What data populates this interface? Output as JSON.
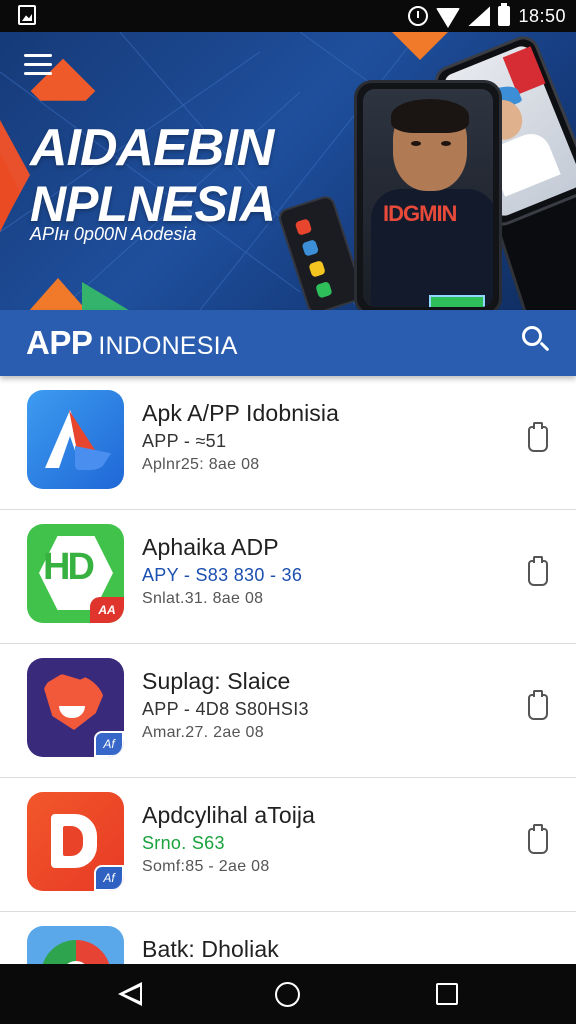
{
  "status_bar": {
    "time": "18:50",
    "icons": [
      "image-icon",
      "alarm-icon",
      "wifi-icon",
      "signal-icon",
      "battery-icon"
    ]
  },
  "banner": {
    "title_line1": "AIDAEBIN",
    "title_line2": "NPLNESIA",
    "subtitle": "APIʜ 0p00N Aodesia",
    "shirt_text": "IDGMIN",
    "menu_icon": "menu-icon"
  },
  "app_bar": {
    "title_bold": "APP",
    "title_rest": "INDONESIA",
    "search_icon": "search-icon",
    "color": "#2a5db0"
  },
  "apps": [
    {
      "name": "Apk A/PP Idobnisia",
      "sub": "APP - ≈51",
      "meta": "Aplnr25: 8ae 08",
      "sub_color": "default"
    },
    {
      "name": "Aphaika ADP",
      "sub": "APY - S83 830 - 36",
      "meta": "Snlat.31. 8ae 08",
      "sub_color": "blue",
      "icon_text": "HD",
      "corner_text": "AA"
    },
    {
      "name": "Suplag: Slaice",
      "sub": "APP - 4D8 S80HSI3",
      "meta": "Amar.27. 2ae 08",
      "sub_color": "default",
      "badge_text": "Af"
    },
    {
      "name": "Apdcylihal aToija",
      "sub": "Srno. S63",
      "meta": "Somf:85 - 2ae 08",
      "sub_color": "green",
      "badge_text": "Af"
    },
    {
      "name": "Batk: Dholiak",
      "sub": "",
      "meta": "",
      "sub_color": "default"
    }
  ],
  "nav": {
    "back_icon": "back-icon",
    "home_icon": "home-icon",
    "recent_icon": "recent-apps-icon"
  }
}
